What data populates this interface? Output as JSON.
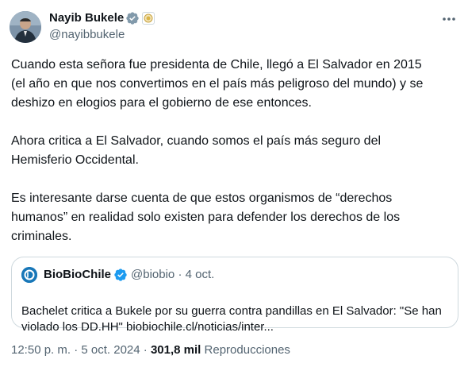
{
  "author": {
    "name": "Nayib Bukele",
    "handle": "@nayibbukele"
  },
  "tweet": {
    "paragraphs": [
      "Cuando esta señora fue presidenta de Chile, llegó a El Salvador en 2015\n(el año en que nos convertimos en el país más peligroso del mundo) y se\ndeshizo en elogios para el gobierno de ese entonces.",
      "Ahora critica a El Salvador, cuando somos el país más seguro del\nHemisferio Occidental.",
      "Es interesante darse cuenta de que estos organismos de “derechos\nhumanos” en realidad solo existen para defender los derechos de los\ncriminales."
    ]
  },
  "quote": {
    "name": "BioBioChile",
    "handle": "@biobio",
    "separator": "·",
    "date": "4 oct.",
    "text": "Bachelet critica a Bukele por su guerra contra pandillas en El Salvador: \"Se han\nviolado los DD.HH\" biobiochile.cl/noticias/inter..."
  },
  "footer": {
    "time": "12:50 p. m.",
    "separator1": "·",
    "date": "5 oct. 2024",
    "separator2": "·",
    "views_count": "301,8 mil",
    "views_label": "Reproducciones"
  },
  "colors": {
    "verified": "#1d9bf0",
    "secondary_text": "#536471",
    "primary_text": "#0f1419",
    "border": "#cfd9de"
  },
  "icons": {
    "verified": "verified-badge-icon",
    "affiliate": "affiliate-badge-icon",
    "more": "more-horizontal-icon"
  }
}
